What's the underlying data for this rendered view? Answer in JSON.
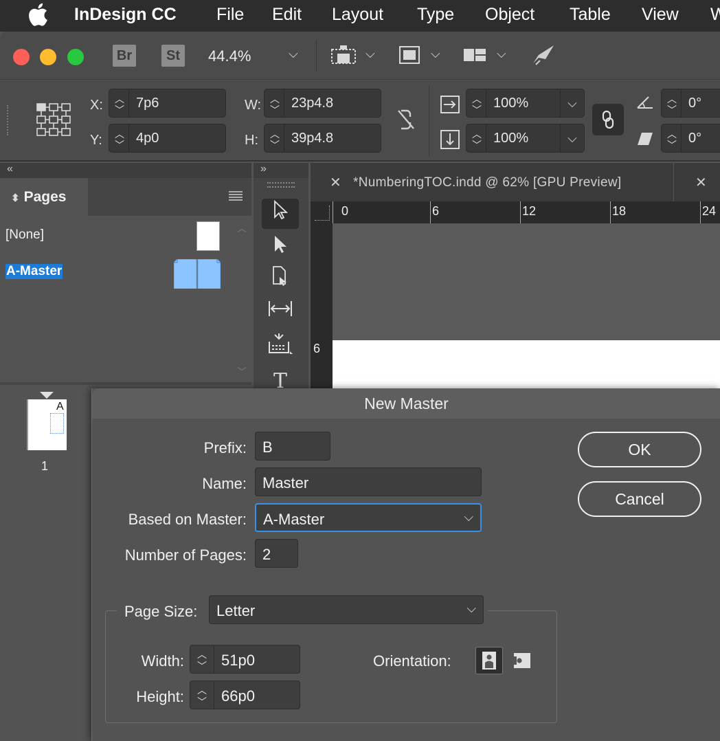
{
  "menubar": {
    "app_name": "InDesign CC",
    "items": [
      "File",
      "Edit",
      "Layout",
      "Type",
      "Object",
      "Table",
      "View",
      "W"
    ]
  },
  "toolbar": {
    "bridge_label": "Br",
    "stock_label": "St",
    "zoom": "44.4%"
  },
  "control": {
    "x_label": "X:",
    "y_label": "Y:",
    "w_label": "W:",
    "h_label": "H:",
    "x_value": "7p6",
    "y_value": "4p0",
    "w_value": "23p4.8",
    "h_value": "39p4.8",
    "scale_x": "100%",
    "scale_y": "100%",
    "rotation": "0°",
    "shear": "0°"
  },
  "panels": {
    "left_collapse": "«",
    "tools_collapse": "»",
    "pages_title": "Pages",
    "none_master": "[None]",
    "a_master": "A-Master",
    "page_prefix": "A",
    "page_number": "1"
  },
  "document": {
    "tab_title": "*NumberingTOC.indd @ 62% [GPU Preview]",
    "ruler_ticks": [
      "0",
      "6",
      "12",
      "18",
      "24"
    ],
    "vruler_tick": "6"
  },
  "dialog": {
    "title": "New Master",
    "prefix_label": "Prefix:",
    "prefix_value": "B",
    "name_label": "Name:",
    "name_value": "Master",
    "based_label": "Based on Master:",
    "based_value": "A-Master",
    "pages_label": "Number of Pages:",
    "pages_value": "2",
    "page_size_label": "Page Size:",
    "page_size_value": "Letter",
    "width_label": "Width:",
    "width_value": "51p0",
    "height_label": "Height:",
    "height_value": "66p0",
    "orientation_label": "Orientation:",
    "ok_label": "OK",
    "cancel_label": "Cancel"
  },
  "colors": {
    "accent": "#0a84ff",
    "selection": "#1d7cd8",
    "master_thumb": "#8cc4ff"
  }
}
